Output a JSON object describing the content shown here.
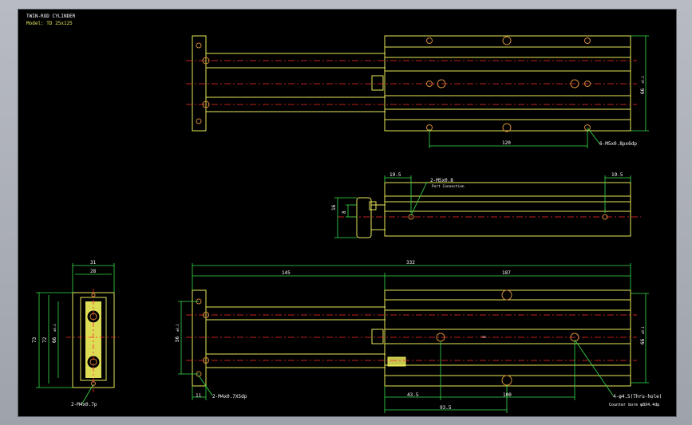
{
  "title": "TWIN-ROD CYLINDER",
  "model": "Model:  TD  25x125",
  "colors": {
    "outline": "#e8e85a",
    "dim": "#35e04a",
    "center": "#ff2a2a",
    "text": "#ffffff",
    "hole": "#d08a3a",
    "bg": "#000000"
  },
  "top_view": {
    "dim_120": "120",
    "dim_66": "66",
    "dim_66_tol": "+0.1",
    "callout": "6-M5x0.8px6dp"
  },
  "side_view": {
    "dim_19_5_left": "19.5",
    "dim_19_5_right": "19.5",
    "dim_16": "16",
    "dim_8": "8",
    "port_callout": "2-M5x0.8",
    "port_sub": "Port Connection"
  },
  "front_view": {
    "dim_31": "31",
    "dim_28": "28",
    "dim_73": "73",
    "dim_72": "72",
    "dim_66": "66",
    "dim_66_tol": "±0.1",
    "callout": "2-M4x0.7p"
  },
  "bottom_view": {
    "dim_332": "332",
    "dim_145": "145",
    "dim_187": "187",
    "dim_56": "56",
    "dim_56_tol": "±0.1",
    "dim_66": "66",
    "dim_66_tol": "±0.1",
    "dim_11": "11",
    "callout_left": "2-M4x0.7X5dp",
    "dim_43_5": "43.5",
    "dim_100": "100",
    "dim_93_5": "93.5",
    "callout_right": "4-φ4.5(Thru-hole)",
    "callout_right_sub": "Counter bore φ8X4.4dp",
    "label_small": "TDR"
  }
}
